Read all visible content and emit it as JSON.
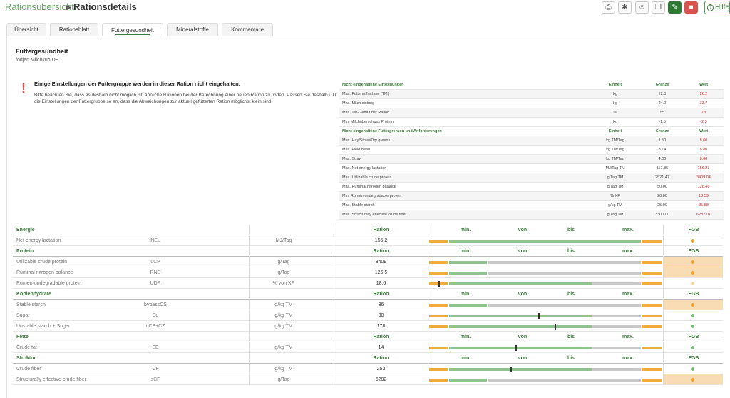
{
  "breadcrumb": {
    "parent": "Rationsübersicht",
    "current": "Rationsdetails"
  },
  "toolbar": {
    "icons": [
      "print-icon",
      "share-icon",
      "group-icon",
      "copy-icon",
      "edit-icon",
      "delete-icon"
    ],
    "help_label": "Hilfe"
  },
  "tabs": [
    {
      "label": "Übersicht",
      "active": false
    },
    {
      "label": "Rationsblatt",
      "active": false
    },
    {
      "label": "Futtergesundheit",
      "active": true
    },
    {
      "label": "Mineralstoffe",
      "active": false
    },
    {
      "label": "Kommentare",
      "active": false
    }
  ],
  "section": {
    "title": "Futtergesundheit",
    "subtitle": "fodjan Milchkuh DE"
  },
  "warning": {
    "title": "Einige Einstellungen der Futtergruppe werden in dieser Ration nicht eingehalten.",
    "text": "Bitte beachten Sie, dass es deshalb nicht möglich ist, ähnliche Rationen bei der Berechnung einer neuen Ration zu finden. Passen Sie deshalb u.U. die Einstellungen der Futtergruppe so an, dass die Abweichungen zur aktuell gefütterten Ration möglichst klein sind."
  },
  "not_respected": {
    "settings_header": {
      "name": "Nicht eingehaltene Einstellungen",
      "unit": "Einheit",
      "limit": "Grenze",
      "value": "Wert"
    },
    "settings": [
      {
        "name": "Max. Futteraufnahme (TM)",
        "unit": "kg",
        "limit": "22.0",
        "value": "26.2"
      },
      {
        "name": "Max. Milchleistung",
        "unit": "kg",
        "limit": "24.0",
        "value": "33.7"
      },
      {
        "name": "Max. TM-Gehalt der Ration",
        "unit": "%",
        "limit": "55",
        "value": "78"
      },
      {
        "name": "Min. Milchüberschuss Protein",
        "unit": "kg",
        "limit": "-1.5",
        "value": "-2.3"
      }
    ],
    "limits_header": {
      "name": "Nicht eingehaltene Futtergrenzen und Anforderungen",
      "unit": "Einheit",
      "limit": "Grenze",
      "value": "Wert"
    },
    "limits": [
      {
        "name": "Max. Hay/Straw/Dry greens",
        "unit": "kg TM/Tag",
        "limit": "1.50",
        "value": "8.60"
      },
      {
        "name": "Max. Field bean",
        "unit": "kg TM/Tag",
        "limit": "3.14",
        "value": "8.80"
      },
      {
        "name": "Max. Straw",
        "unit": "kg TM/Tag",
        "limit": "4.00",
        "value": "8.60"
      },
      {
        "name": "Max. Net energy lactation",
        "unit": "MJ/Tag TM",
        "limit": "117.85",
        "value": "156.23"
      },
      {
        "name": "Max. Utilizable crude protein",
        "unit": "g/Tag TM",
        "limit": "2521.47",
        "value": "3409.04"
      },
      {
        "name": "Max. Ruminal nitrogen balance",
        "unit": "g/Tag TM",
        "limit": "50.00",
        "value": "126.46"
      },
      {
        "name": "Min. Rumen-undegradable protein",
        "unit": "% XP",
        "limit": "20.00",
        "value": "18.59"
      },
      {
        "name": "Max. Stable starch",
        "unit": "g/kg TM",
        "limit": "25.00",
        "value": "35.88"
      },
      {
        "name": "Max. Structurally effective crude fiber",
        "unit": "g/Tag TM",
        "limit": "3300.00",
        "value": "6282.07"
      }
    ]
  },
  "main_table": {
    "col_labels": {
      "ration": "Ration",
      "min": "min.",
      "von": "von",
      "bis": "bis",
      "max": "max.",
      "fgb": "FGB"
    },
    "groups": [
      {
        "name": "Energie",
        "rows": [
          {
            "name": "Net energy lactation",
            "abbr": "NEL",
            "unit": "MJ/Tag",
            "ration": "156.2",
            "status": "warn",
            "highlight": false,
            "marker": null
          }
        ]
      },
      {
        "name": "Protein",
        "rows": [
          {
            "name": "Utilizable crude protein",
            "abbr": "uCP",
            "unit": "g/Tag",
            "ration": "3409",
            "status": "warn",
            "highlight": true,
            "marker": null
          },
          {
            "name": "Ruminal nitrogen balance",
            "abbr": "RNB",
            "unit": "g/Tag",
            "ration": "126.5",
            "status": "warn",
            "highlight": true,
            "marker": null
          },
          {
            "name": "Rumen-undegradable protein",
            "abbr": "UDP",
            "unit": "% von XP",
            "ration": "18.6",
            "status": "light",
            "highlight": false,
            "marker": 0.04
          }
        ]
      },
      {
        "name": "Kohlenhydrate",
        "rows": [
          {
            "name": "Stable starch",
            "abbr": "bypassCS",
            "unit": "g/kg TM",
            "ration": "36",
            "status": "warn",
            "highlight": true,
            "marker": null
          },
          {
            "name": "Sugar",
            "abbr": "Su",
            "unit": "g/kg TM",
            "ration": "30",
            "status": "ok",
            "highlight": false,
            "marker": 0.47
          },
          {
            "name": "Unstable starch + Sugar",
            "abbr": "uCS+CZ",
            "unit": "g/kg TM",
            "ration": "178",
            "status": "ok",
            "highlight": false,
            "marker": 0.54
          }
        ]
      },
      {
        "name": "Fette",
        "rows": [
          {
            "name": "Crude fat",
            "abbr": "EE",
            "unit": "g/kg TM",
            "ration": "14",
            "status": "ok",
            "highlight": false,
            "marker": 0.37
          }
        ]
      },
      {
        "name": "Struktur",
        "rows": [
          {
            "name": "Crude fiber",
            "abbr": "CF",
            "unit": "g/kg TM",
            "ration": "253",
            "status": "ok",
            "highlight": false,
            "marker": 0.35
          },
          {
            "name": "Structurally effective crude fiber",
            "abbr": "sCF",
            "unit": "g/Tag",
            "ration": "6282",
            "status": "warn",
            "highlight": true,
            "marker": null
          }
        ]
      }
    ]
  },
  "colors": {
    "green": "#8fc48f",
    "orange": "#f0ad3c",
    "grey": "#c8c8c8",
    "highlight": "#f7dcb4",
    "dot_warn": "#f0a030",
    "dot_ok": "#7ab87a",
    "dot_light": "#f5d8a8"
  }
}
